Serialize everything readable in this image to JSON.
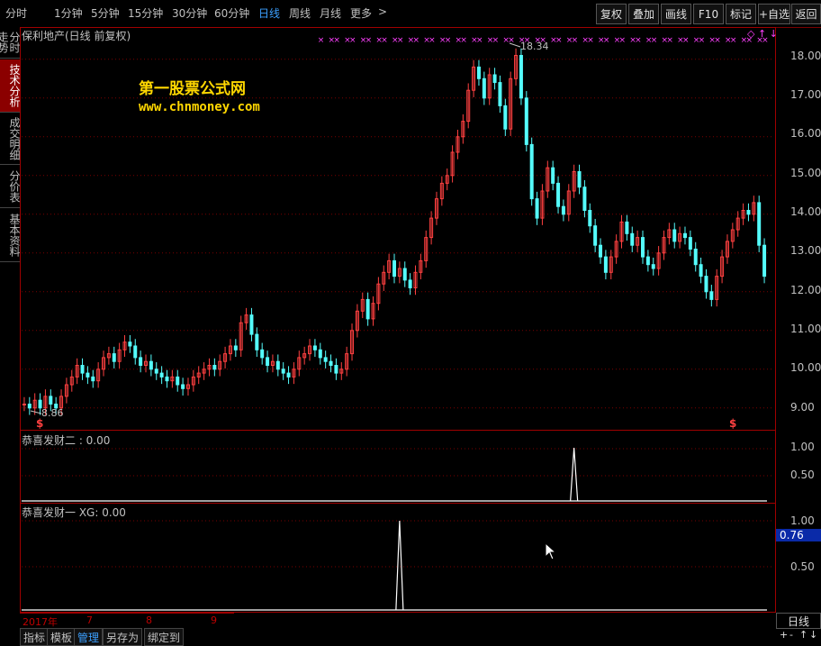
{
  "toolbar": {
    "periods": [
      "分时",
      "1分钟",
      "5分钟",
      "15分钟",
      "30分钟",
      "60分钟",
      "日线",
      "周线",
      "月线",
      "更多"
    ],
    "active_period": "日线",
    "more_arrow": ">",
    "buttons": [
      "复权",
      "叠加",
      "画线",
      "F10",
      "标记",
      "+自选",
      "返回"
    ]
  },
  "left_tabs": [
    "分时走势",
    "技术分析",
    "成交明细",
    "分价表",
    "基本资料"
  ],
  "active_left_tab": "技术分析",
  "main_chart": {
    "title": "保利地产(日线 前复权)",
    "high_label": "18.34",
    "low_label": "8.86",
    "watermark_name": "第一股票公式网",
    "watermark_url": "www.chnmoney.com",
    "y_ticks": [
      "18.00",
      "17.00",
      "16.00",
      "15.00",
      "14.00",
      "13.00",
      "12.00",
      "11.00",
      "10.00",
      "9.00"
    ],
    "top_right_marks": "◇ ↑ ↓"
  },
  "indicator1": {
    "title": "恭喜发财二 : 0.00",
    "y_ticks": [
      "1.00",
      "0.50"
    ]
  },
  "indicator2": {
    "title": "恭喜发财一  XG: 0.00",
    "y_ticks": [
      "1.00",
      "0.50"
    ],
    "cursor_value": "0.76"
  },
  "date_axis": [
    "2017年",
    "7",
    "8",
    "9"
  ],
  "bottom_tabs": [
    "指标",
    "模板",
    "管理",
    "另存为",
    "绑定到"
  ],
  "active_bottom_tab": "管理",
  "period_indicator": "日线",
  "bottom_right_controls": [
    "+",
    "-",
    "↑",
    "↓"
  ],
  "signal_marks": [
    "$",
    "$"
  ],
  "colors": {
    "up": "#ff4040",
    "down": "#54fcfc",
    "accent": "#3ca0ff",
    "border": "#a00000",
    "watermark": "#ffd700",
    "signal_marks": "#ff40ff"
  },
  "chart_data": {
    "type": "candlestick",
    "title": "保利地产(日线 前复权)",
    "y_range": [
      8.6,
      18.6
    ],
    "close_series": [
      9.1,
      9.0,
      9.2,
      9.0,
      9.3,
      9.1,
      9.0,
      9.3,
      9.6,
      9.8,
      10.1,
      9.9,
      9.8,
      9.7,
      10.0,
      10.3,
      10.4,
      10.2,
      10.5,
      10.7,
      10.6,
      10.3,
      10.1,
      10.2,
      10.0,
      9.9,
      9.8,
      9.7,
      9.8,
      9.6,
      9.5,
      9.6,
      9.8,
      9.9,
      10.0,
      10.1,
      10.0,
      10.2,
      10.4,
      10.6,
      10.5,
      11.2,
      11.4,
      10.9,
      10.5,
      10.3,
      10.1,
      10.2,
      10.0,
      9.9,
      9.8,
      10.0,
      10.3,
      10.4,
      10.6,
      10.5,
      10.3,
      10.2,
      10.1,
      9.9,
      10.0,
      10.4,
      11.0,
      11.5,
      11.8,
      11.3,
      11.7,
      12.2,
      12.5,
      12.8,
      12.4,
      12.6,
      12.3,
      12.1,
      12.5,
      12.8,
      13.4,
      13.9,
      14.4,
      14.8,
      15.0,
      15.6,
      16.0,
      16.4,
      17.2,
      17.8,
      17.5,
      17.0,
      17.6,
      17.4,
      16.8,
      16.2,
      17.5,
      18.1,
      17.0,
      15.8,
      14.4,
      13.9,
      14.6,
      15.2,
      14.8,
      14.2,
      14.0,
      14.6,
      15.1,
      14.7,
      14.1,
      13.7,
      13.2,
      12.9,
      12.5,
      12.9,
      13.3,
      13.8,
      13.5,
      13.2,
      13.4,
      12.9,
      12.7,
      12.6,
      13.0,
      13.4,
      13.6,
      13.3,
      13.5,
      13.4,
      13.1,
      12.7,
      12.4,
      12.0,
      11.8,
      12.4,
      12.9,
      13.3,
      13.6,
      13.9,
      14.1,
      14.0,
      14.3,
      13.2,
      12.4
    ],
    "indicator1_spike_index": 104,
    "indicator2_spike_index": 71
  }
}
